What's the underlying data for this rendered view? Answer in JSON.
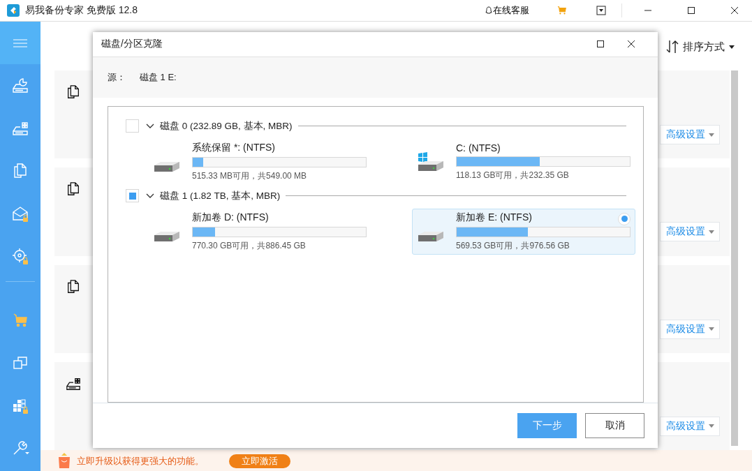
{
  "window": {
    "title": "易我备份专家 免费版 12.8",
    "support": "在线客服"
  },
  "sidebar": {
    "items": [
      {
        "kind": "menu",
        "locked": false,
        "selected": true
      },
      {
        "kind": "disk-chart",
        "locked": false,
        "selected": false
      },
      {
        "kind": "disk-grid",
        "locked": false,
        "selected": false
      },
      {
        "kind": "files",
        "locked": false,
        "selected": false
      },
      {
        "kind": "mail",
        "locked": true,
        "selected": false
      },
      {
        "kind": "target",
        "locked": true,
        "selected": false
      },
      {
        "kind": "cart",
        "locked": false,
        "selected": false
      },
      {
        "kind": "clone",
        "locked": false,
        "selected": false
      },
      {
        "kind": "tiles",
        "locked": true,
        "selected": false
      },
      {
        "kind": "tools",
        "locked": false,
        "selected": false
      }
    ]
  },
  "sort": {
    "label": "排序方式"
  },
  "cards": [
    {
      "kind": "files",
      "button": "高级设置"
    },
    {
      "kind": "files",
      "button": "高级设置"
    },
    {
      "kind": "files",
      "button": "高级设置"
    },
    {
      "kind": "disk",
      "button": "高级设置"
    }
  ],
  "dialog": {
    "title": "磁盘/分区克隆",
    "source_label": "源：",
    "source_value": "磁盘 1 E:",
    "disks": [
      {
        "label": "磁盘 0 (232.89 GB, 基本, MBR)",
        "checked": false,
        "partitions": [
          {
            "name": "系统保留 *: (NTFS)",
            "system": false,
            "level": 0.06,
            "usage": "515.33 MB可用，共549.00 MB",
            "selected": false
          },
          {
            "name": "C: (NTFS)",
            "system": true,
            "level": 0.48,
            "usage": "118.13 GB可用，共232.35 GB",
            "selected": false
          }
        ]
      },
      {
        "label": "磁盘 1 (1.82 TB, 基本, MBR)",
        "checked": true,
        "partitions": [
          {
            "name": "新加卷 D: (NTFS)",
            "system": false,
            "level": 0.13,
            "usage": "770.30 GB可用，共886.45 GB",
            "selected": false
          },
          {
            "name": "新加卷 E: (NTFS)",
            "system": false,
            "level": 0.41,
            "usage": "569.53 GB可用，共976.56 GB",
            "selected": true
          }
        ]
      }
    ],
    "buttons": [
      {
        "label": "下一步",
        "kind": "primary"
      },
      {
        "label": "取消",
        "kind": "secondary"
      }
    ]
  },
  "banner": {
    "text": "立即升级以获得更强大的功能。",
    "button": "立即激活"
  }
}
